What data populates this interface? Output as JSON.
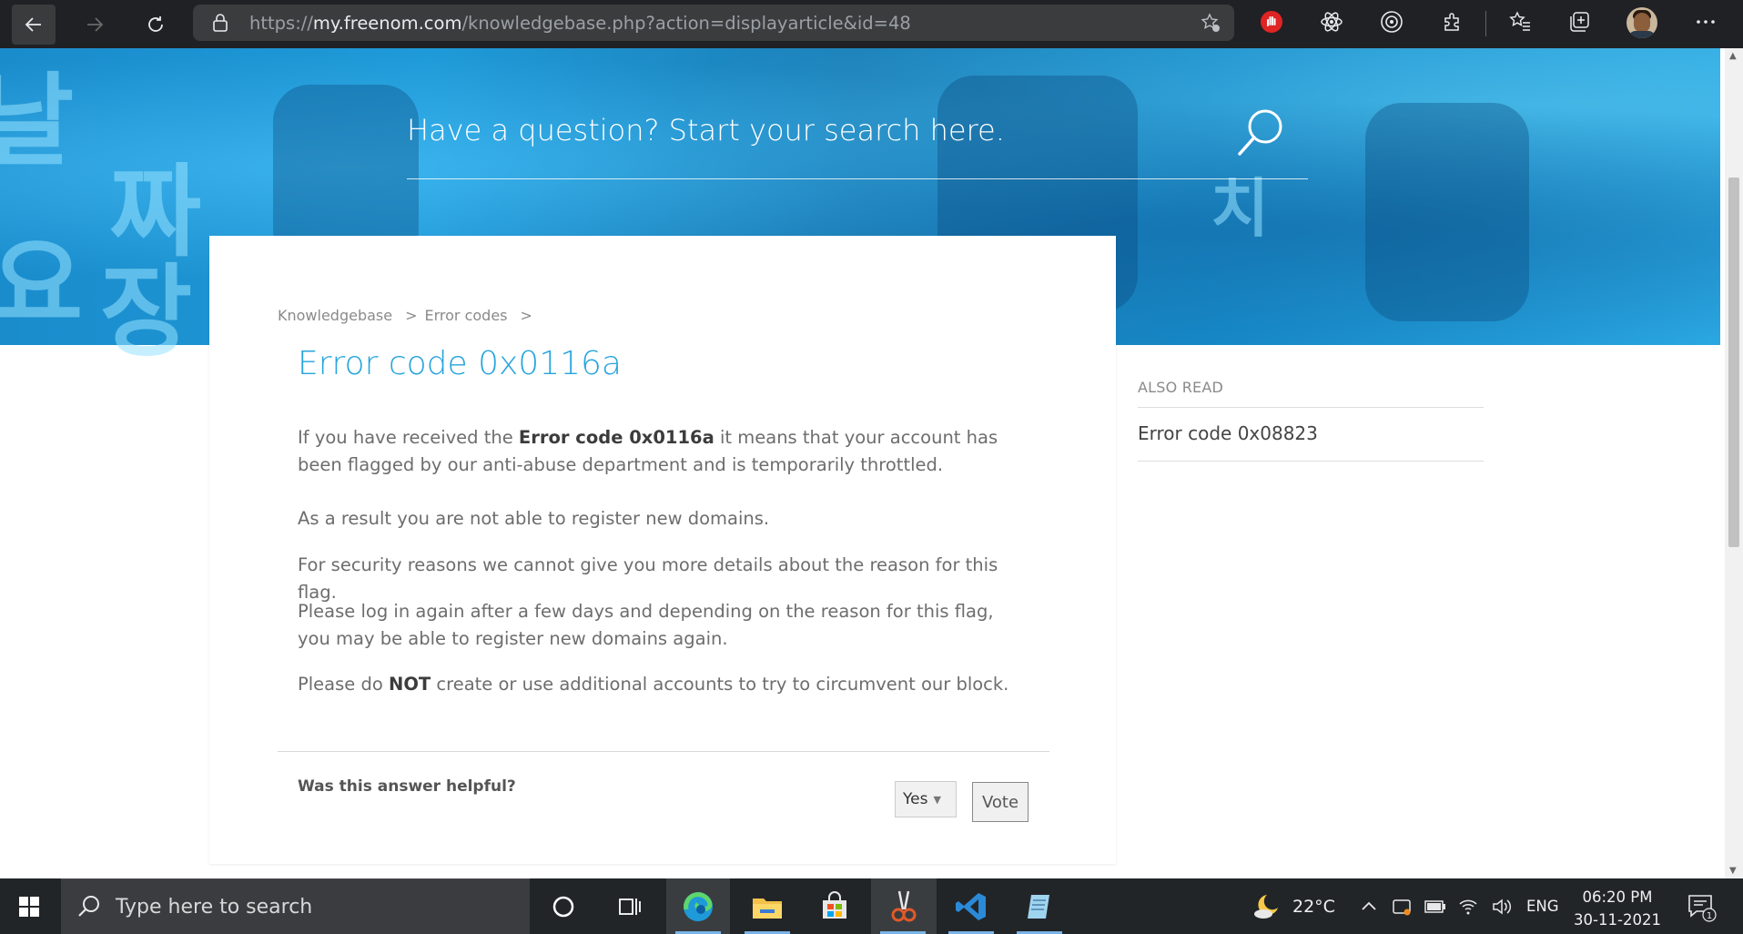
{
  "browser": {
    "url_prefix": "https://",
    "url_host": "my.freenom.com",
    "url_path": "/knowledgebase.php?action=displayarticle&id=48"
  },
  "hero": {
    "search_placeholder": "Have a question? Start your search here."
  },
  "breadcrumb": {
    "items": [
      "Knowledgebase",
      "Error codes"
    ],
    "separator": ">"
  },
  "article": {
    "title": "Error code 0x0116a",
    "p1_before": "If you have received the ",
    "p1_bold": "Error code 0x0116a",
    "p1_after": " it means that your account has been flagged by our anti-abuse department and is temporarily throttled.",
    "p2": "As a result you are not able to register new domains.",
    "p3": "For security reasons we cannot give you more details about the reason for this flag.",
    "p4": "Please log in again after a few days and depending on the reason for this flag, you may be able to register new domains again.",
    "p5_before": "Please do ",
    "p5_bold": "NOT",
    "p5_after": " create or use additional accounts to try to circumvent our block."
  },
  "feedback": {
    "question": "Was this answer helpful?",
    "selected": "Yes",
    "vote_label": "Vote"
  },
  "also_read": {
    "heading": "ALSO READ",
    "items": [
      "Error code 0x08823"
    ]
  },
  "taskbar": {
    "search_placeholder": "Type here to search",
    "temperature": "22°C",
    "language": "ENG",
    "time": "06:20 PM",
    "date": "30-11-2021",
    "notification_count": "1"
  },
  "colors": {
    "accent": "#26a4dc",
    "hero": "#1f9ad8",
    "toolbar": "#202124",
    "taskbar": "#222528"
  }
}
